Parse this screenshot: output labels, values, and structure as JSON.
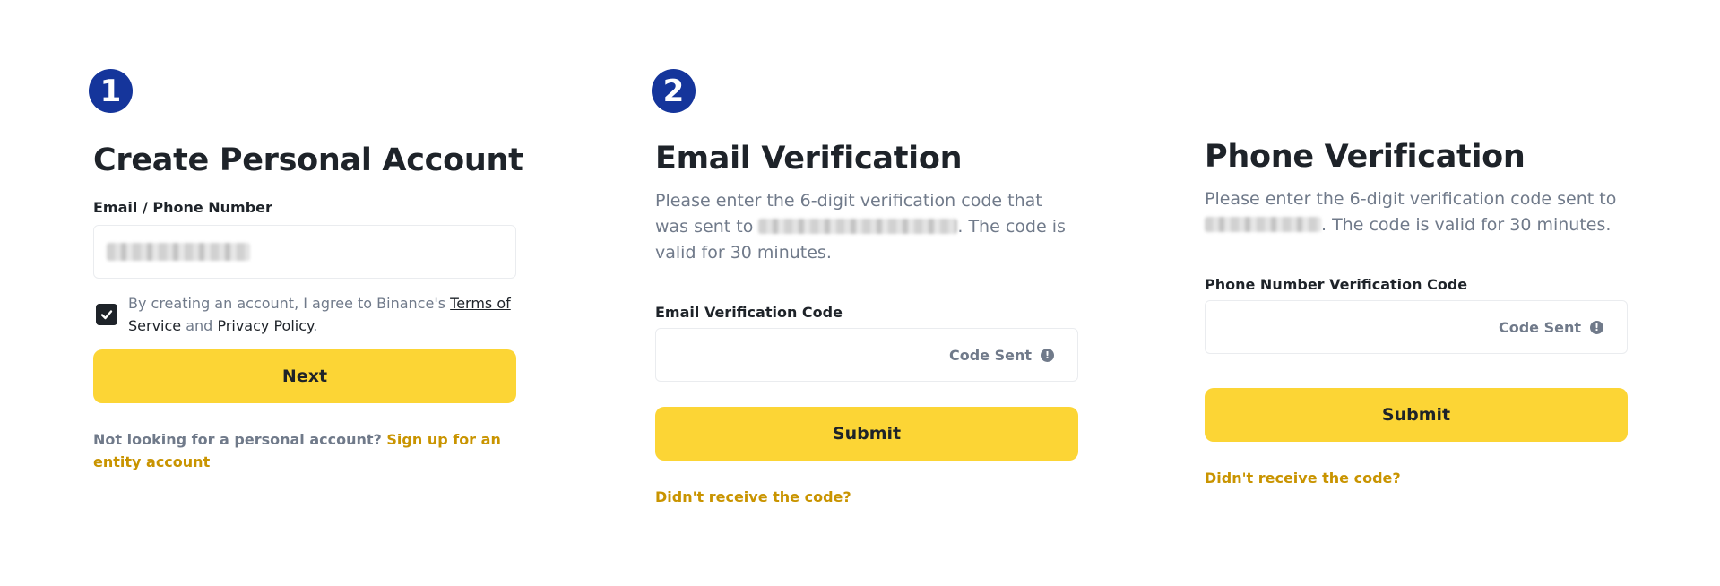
{
  "steps": [
    "1",
    "2"
  ],
  "create_account": {
    "title": "Create Personal Account",
    "field_label": "Email / Phone Number",
    "field_value_hidden": true,
    "terms_prefix": "By creating an account, I agree to Binance's",
    "terms_link": "Terms of Service",
    "terms_and": "and",
    "privacy_link": "Privacy Policy",
    "terms_suffix": ".",
    "checkbox_checked": true,
    "next_label": "Next",
    "entity_prompt": "Not looking for a personal account?",
    "entity_link": "Sign up for an entity account"
  },
  "email_verification": {
    "title": "Email Verification",
    "desc_prefix": "Please enter the 6-digit verification code that was sent to",
    "desc_suffix": ". The code is valid for 30 minutes.",
    "field_label": "Email Verification Code",
    "code_sent": "Code Sent",
    "submit_label": "Submit",
    "resend_link": "Didn't receive the code?"
  },
  "phone_verification": {
    "title": "Phone Verification",
    "desc_prefix": "Please enter the 6-digit verification code sent to",
    "desc_suffix": ". The code is valid for 30 minutes.",
    "field_label": "Phone Number Verification Code",
    "code_sent": "Code Sent",
    "submit_label": "Submit",
    "resend_link": "Didn't receive the code?"
  },
  "icons": {
    "info": "info-circle-icon",
    "check": "checkmark-icon"
  },
  "colors": {
    "accent": "#fcd535",
    "link": "#c99400",
    "badge": "#15359b",
    "text": "#1e2329",
    "muted": "#707a8a"
  }
}
